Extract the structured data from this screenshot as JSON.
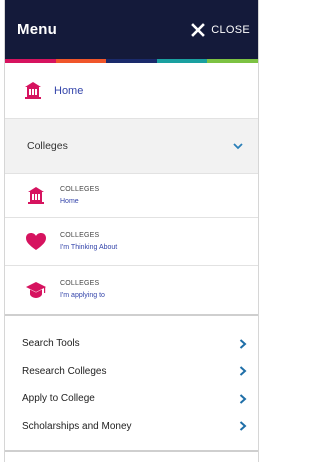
{
  "header": {
    "title": "Menu",
    "close_label": "CLOSE"
  },
  "colors": {
    "header_bg": "#141a3a",
    "accent": "#d6135f",
    "link": "#3344aa",
    "stripe": [
      "#d6135f",
      "#f0562a",
      "#1a2a6b",
      "#1aa0a0",
      "#7cc242"
    ]
  },
  "home": {
    "label": "Home",
    "icon": "school-building-icon"
  },
  "colleges_section": {
    "label": "Colleges",
    "icon": "chevron-down-icon"
  },
  "college_items": [
    {
      "caption": "COLLEGES",
      "link": "Home",
      "icon": "school-building-icon"
    },
    {
      "caption": "COLLEGES",
      "link": "I'm Thinking About",
      "icon": "heart-icon"
    },
    {
      "caption": "COLLEGES",
      "link": "I'm applying to",
      "icon": "graduation-cap-icon"
    }
  ],
  "tools": [
    {
      "label": "Search Tools"
    },
    {
      "label": "Research Colleges"
    },
    {
      "label": "Apply to College"
    },
    {
      "label": "Scholarships and Money"
    }
  ]
}
